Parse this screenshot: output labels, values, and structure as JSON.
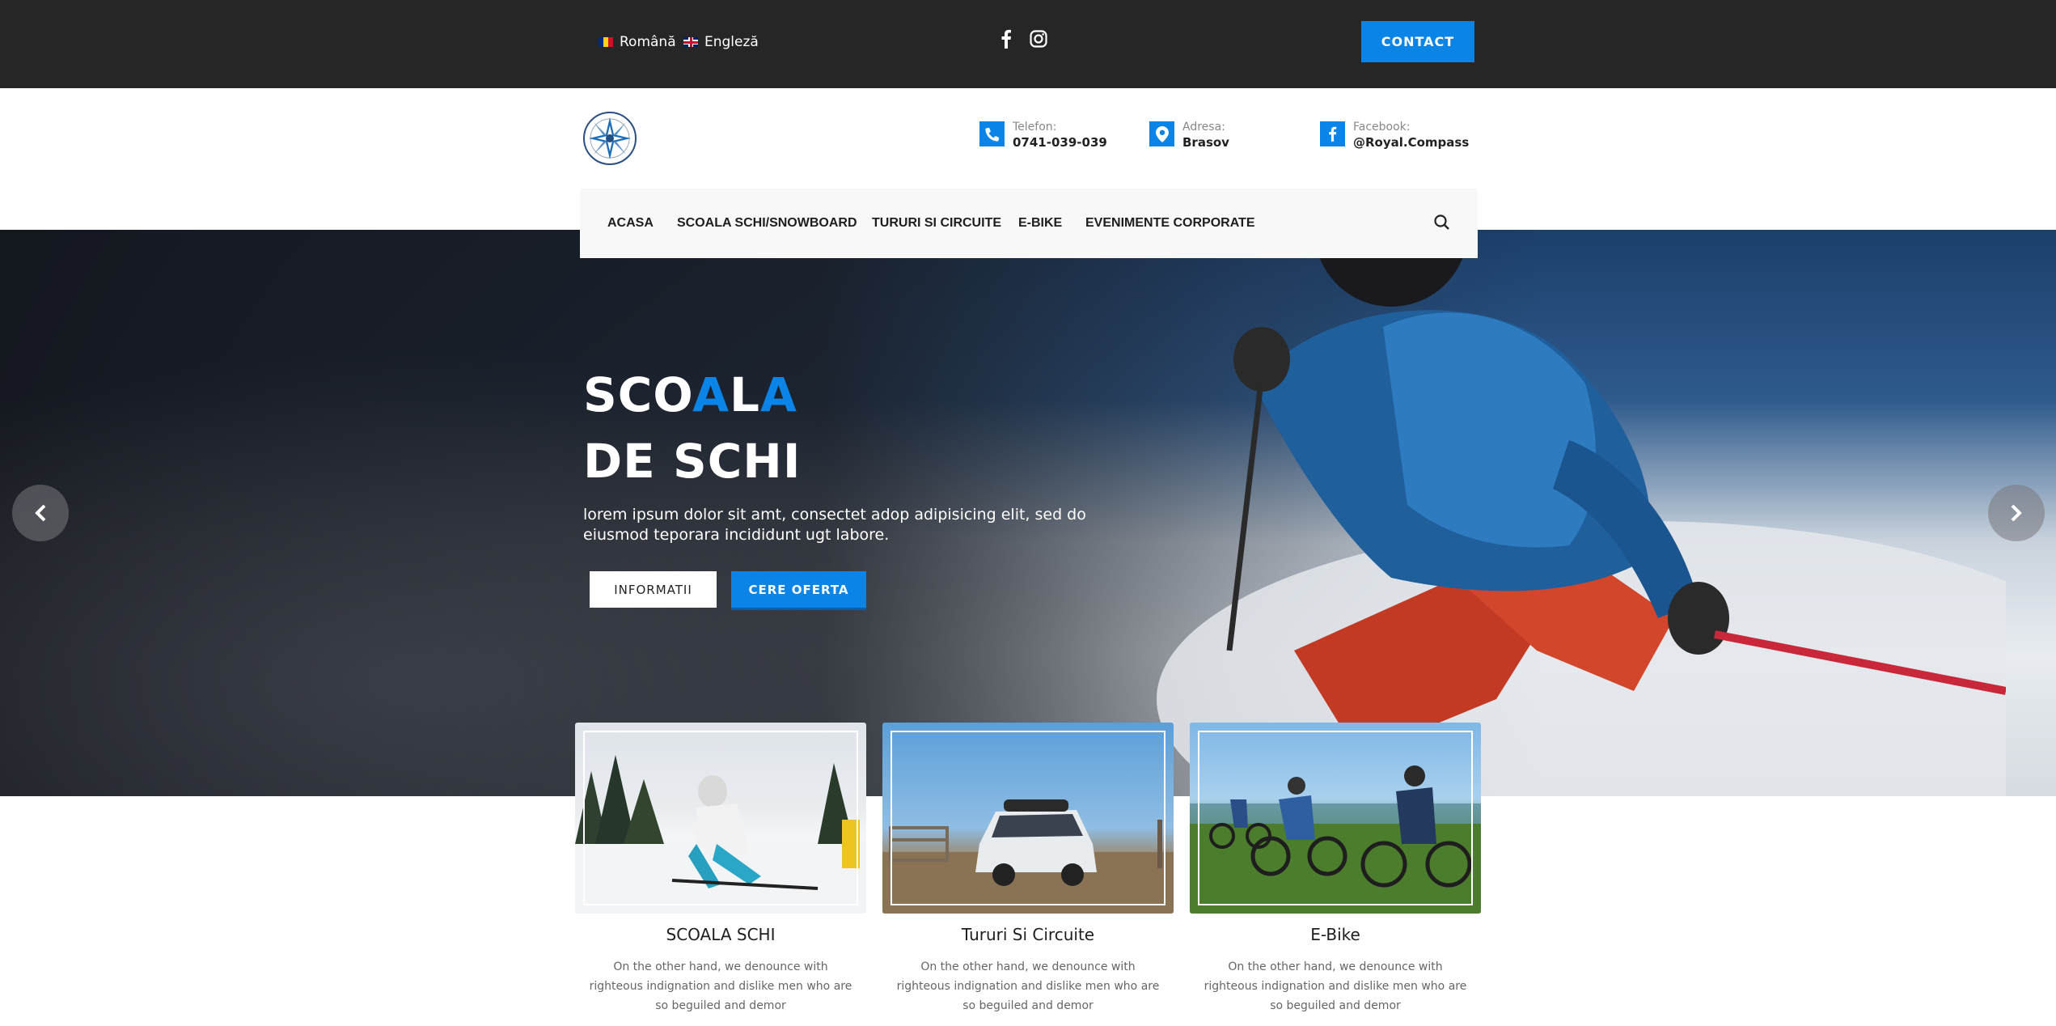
{
  "topbar": {
    "languages": [
      {
        "label": "Română",
        "flag": "ro-flag-icon"
      },
      {
        "label": "Engleză",
        "flag": "uk-flag-icon"
      }
    ],
    "social_icons": [
      "facebook-icon",
      "instagram-icon"
    ],
    "contact_label": "CONTACT"
  },
  "header": {
    "logo": "royal-compass-logo",
    "info": [
      {
        "icon": "phone-icon",
        "label": "Telefon:",
        "value": "0741-039-039"
      },
      {
        "icon": "location-pin-icon",
        "label": "Adresa:",
        "value": "Brasov"
      },
      {
        "icon": "facebook-icon",
        "label": "Facebook:",
        "value": "@Royal.Compass"
      }
    ]
  },
  "nav": {
    "items": [
      "ACASA",
      "SCOALA SCHI/SNOWBOARD",
      "TURURI SI CIRCUITE",
      "E-BIKE",
      "EVENIMENTE CORPORATE"
    ],
    "search_icon": "search-icon"
  },
  "hero": {
    "title_line1_white_a": "SCO",
    "title_line1_blue_a": "A",
    "title_line1_white_b": "L",
    "title_line1_blue_b": "A",
    "title_line2": "DE SCHI",
    "description": "lorem ipsum dolor sit amt, consectet adop adipisicing elit, sed do eiusmod teporara incididunt ugt labore.",
    "btn_info": "INFORMATII",
    "btn_offer": "CERE OFERTA",
    "prev_icon": "chevron-left-icon",
    "next_icon": "chevron-right-icon"
  },
  "cards": [
    {
      "title": "SCOALA SCHI",
      "text": "On the other hand, we denounce with righteous indignation and dislike men who are so beguiled and demor"
    },
    {
      "title": "Tururi Si Circuite",
      "text": "On the other hand, we denounce with righteous indignation and dislike men who are so beguiled and demor"
    },
    {
      "title": "E-Bike",
      "text": "On the other hand, we denounce with righteous indignation and dislike men who are so beguiled and demor"
    }
  ],
  "colors": {
    "accent": "#0a84e6",
    "topbar": "#262626"
  }
}
